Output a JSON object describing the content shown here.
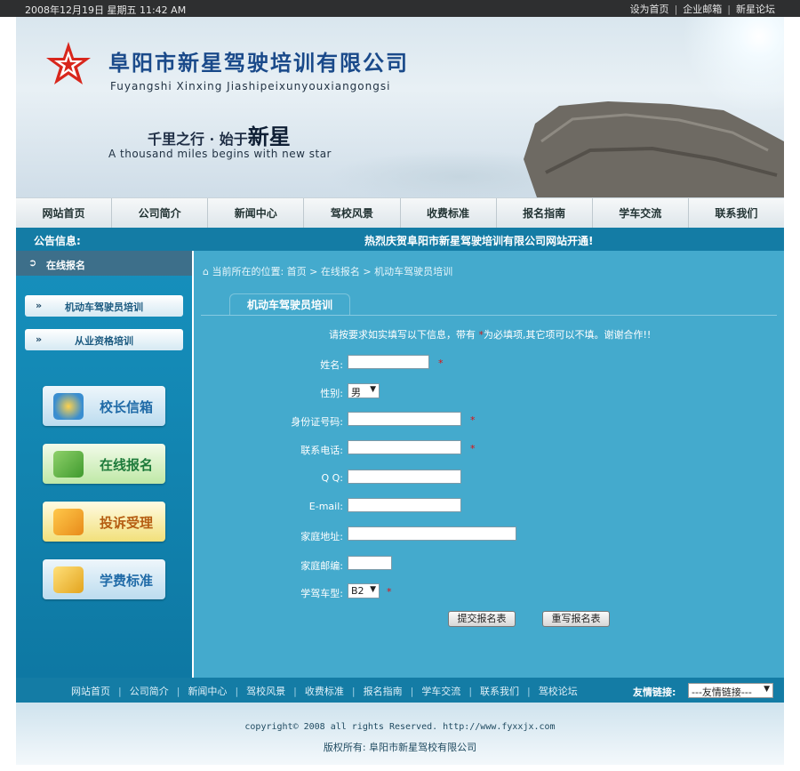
{
  "topbar": {
    "date": "2008年12月19日 星期五 11:42 AM",
    "links": [
      "设为首页",
      "企业邮箱",
      "新星论坛"
    ]
  },
  "banner": {
    "company_cn": "阜阳市新星驾驶培训有限公司",
    "company_en": "Fuyangshi Xinxing Jiashipeixunyouxiangongsi",
    "slogan_prefix": "千里之行 · 始于",
    "slogan_emph": "新星",
    "slogan_en": "A thousand miles begins with new star"
  },
  "nav": {
    "items": [
      "网站首页",
      "公司简介",
      "新闻中心",
      "驾校风景",
      "收费标准",
      "报名指南",
      "学车交流",
      "联系我们"
    ]
  },
  "notice": {
    "label": "公告信息:",
    "message": "热烈庆贺阜阳市新星驾驶培训有限公司网站开通!"
  },
  "sidebar": {
    "title": "在线报名",
    "buttons": [
      "机动车驾驶员培训",
      "从业资格培训"
    ],
    "tiles": [
      "校长信箱",
      "在线报名",
      "投诉受理",
      "学费标准"
    ]
  },
  "main": {
    "breadcrumb": "当前所在的位置: 首页 > 在线报名 > 机动车驾驶员培训",
    "tab": "机动车驾驶员培训",
    "intro_prefix": "请按要求如实填写以下信息，带有",
    "intro_star": "*",
    "intro_suffix": "为必填项,其它项可以不填。谢谢合作!!",
    "fields": {
      "name": "姓名:",
      "gender": "性别:",
      "gender_value": "男",
      "id_number": "身份证号码:",
      "phone": "联系电话:",
      "qq": "Q Q:",
      "email": "E-mail:",
      "address": "家庭地址:",
      "postcode": "家庭邮编:",
      "car_type": "学驾车型:",
      "car_type_value": "B2"
    },
    "required_mark": "*",
    "submit": "提交报名表",
    "reset": "重写报名表"
  },
  "footer": {
    "links": [
      "网站首页",
      "公司简介",
      "新闻中心",
      "驾校风景",
      "收费标准",
      "报名指南",
      "学车交流",
      "联系我们",
      "驾校论坛"
    ],
    "friend_label": "友情链接:",
    "friend_select": "---友情链接---",
    "copyright": "copyright© 2008 all rights Reserved. http://www.fyxxjx.com",
    "owner": "版权所有: 阜阳市新星驾校有限公司"
  },
  "colors": {
    "accent": "#147ca5",
    "content_bg": "#44aacd",
    "required": "#e01010"
  }
}
